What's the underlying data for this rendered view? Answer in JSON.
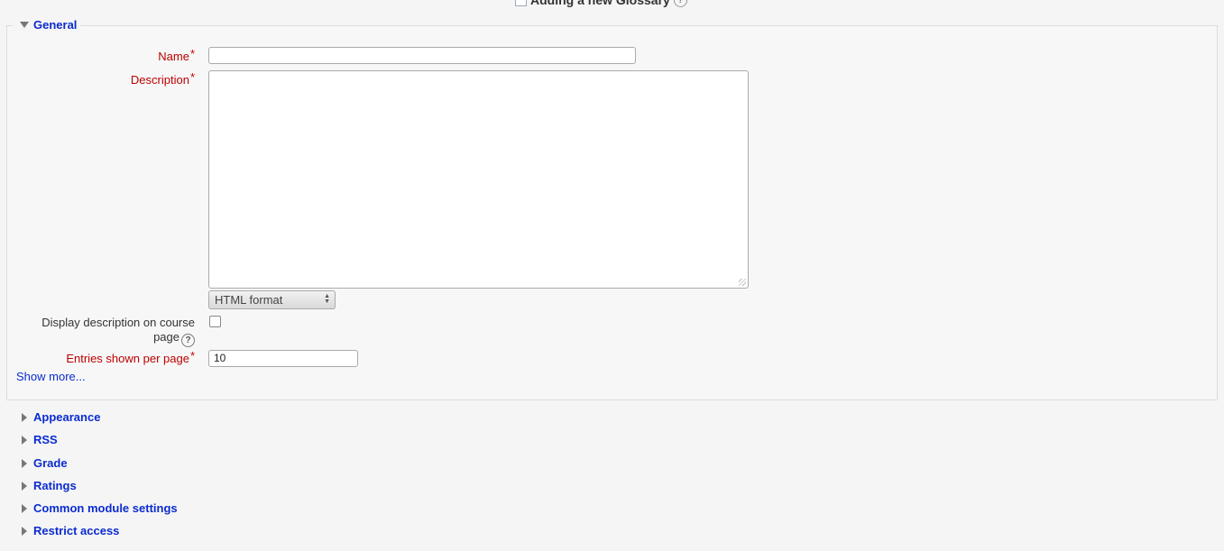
{
  "page": {
    "title": "Adding a new Glossary"
  },
  "general": {
    "legend": "General",
    "name_label": "Name",
    "name_value": "",
    "description_label": "Description",
    "description_value": "",
    "format_selected": "HTML format",
    "display_desc_label_line1": "Display description on course",
    "display_desc_label_line2": "page",
    "display_desc_checked": false,
    "entries_label": "Entries shown per page",
    "entries_value": "10",
    "required_mark": "*",
    "show_more": "Show more..."
  },
  "sections": [
    {
      "label": "Appearance"
    },
    {
      "label": "RSS"
    },
    {
      "label": "Grade"
    },
    {
      "label": "Ratings"
    },
    {
      "label": "Common module settings"
    },
    {
      "label": "Restrict access"
    }
  ],
  "colors": {
    "link": "#0b2bd0",
    "required": "#cc0000",
    "label_required": "#bb0000"
  },
  "icons": {
    "expanded": "triangle-down",
    "collapsed": "triangle-right",
    "help": "question-circle"
  }
}
